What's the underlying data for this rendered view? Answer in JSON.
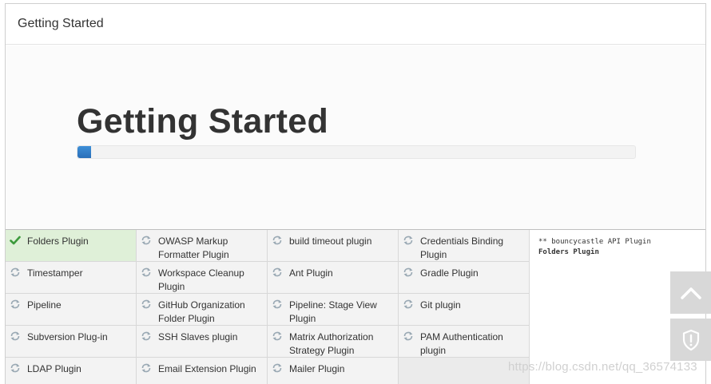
{
  "window": {
    "title": "Getting Started"
  },
  "hero": {
    "heading": "Getting Started",
    "progress_fraction": 0.025
  },
  "plugins": [
    [
      {
        "name": "Folders Plugin",
        "status": "done"
      },
      {
        "name": "OWASP Markup Formatter Plugin",
        "status": "pending"
      },
      {
        "name": "build timeout plugin",
        "status": "pending"
      },
      {
        "name": "Credentials Binding Plugin",
        "status": "pending"
      }
    ],
    [
      {
        "name": "Timestamper",
        "status": "pending"
      },
      {
        "name": "Workspace Cleanup Plugin",
        "status": "pending"
      },
      {
        "name": "Ant Plugin",
        "status": "pending"
      },
      {
        "name": "Gradle Plugin",
        "status": "pending"
      }
    ],
    [
      {
        "name": "Pipeline",
        "status": "pending"
      },
      {
        "name": "GitHub Organization Folder Plugin",
        "status": "pending"
      },
      {
        "name": "Pipeline: Stage View Plugin",
        "status": "pending"
      },
      {
        "name": "Git plugin",
        "status": "pending"
      }
    ],
    [
      {
        "name": "Subversion Plug-in",
        "status": "pending"
      },
      {
        "name": "SSH Slaves plugin",
        "status": "pending"
      },
      {
        "name": "Matrix Authorization Strategy Plugin",
        "status": "pending"
      },
      {
        "name": "PAM Authentication plugin",
        "status": "pending"
      }
    ],
    [
      {
        "name": "LDAP Plugin",
        "status": "pending"
      },
      {
        "name": "Email Extension Plugin",
        "status": "pending"
      },
      {
        "name": "Mailer Plugin",
        "status": "pending"
      },
      {
        "name": "",
        "status": "blank"
      }
    ]
  ],
  "log": {
    "line1": "** bouncycastle API Plugin",
    "line2": "Folders Plugin"
  },
  "side_buttons": {
    "top_icon": "chevron-up-icon",
    "bottom_icon": "shield-icon"
  },
  "watermark": "https://blog.csdn.net/qq_36574133",
  "colors": {
    "done_bg": "#dff0d8",
    "pending_bg": "#f3f3f3",
    "progress": "#2a6fb8",
    "check": "#3c9a3c"
  }
}
